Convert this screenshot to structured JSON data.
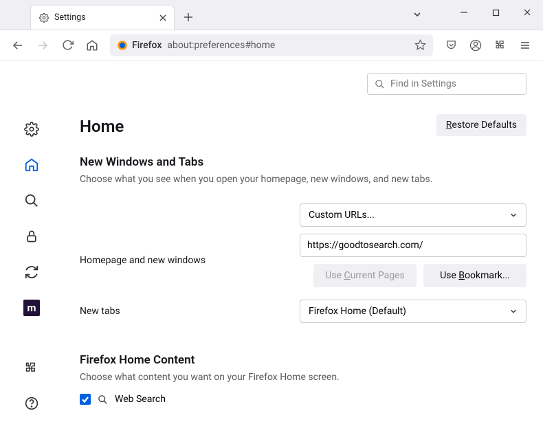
{
  "tab": {
    "title": "Settings"
  },
  "url": {
    "identity": "Firefox",
    "value": "about:preferences#home"
  },
  "search": {
    "placeholder": "Find in Settings"
  },
  "page": {
    "title": "Home",
    "restore": "Restore Defaults",
    "section1_title": "New Windows and Tabs",
    "section1_sub": "Choose what you see when you open your homepage, new windows, and new tabs.",
    "homepage_label": "Homepage and new windows",
    "homepage_select": "Custom URLs...",
    "homepage_url": "https://goodtosearch.com/",
    "use_current": "Use Current Pages",
    "use_bookmark": "Use Bookmark...",
    "newtabs_label": "New tabs",
    "newtabs_select": "Firefox Home (Default)",
    "section2_title": "Firefox Home Content",
    "section2_sub": "Choose what content you want on your Firefox Home screen.",
    "websearch": "Web Search"
  }
}
